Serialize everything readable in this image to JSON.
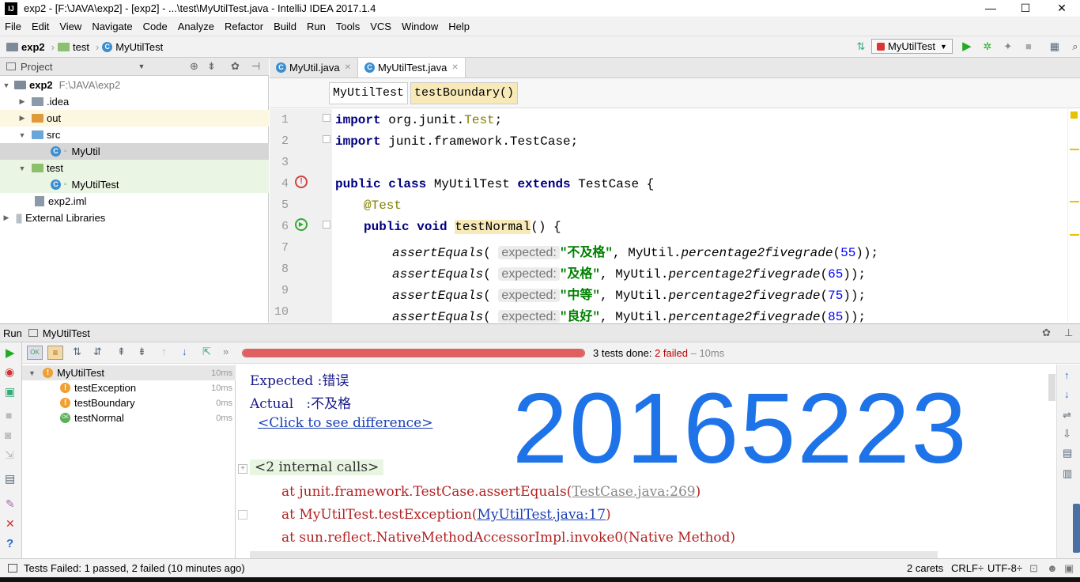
{
  "window": {
    "title": "exp2 - [F:\\JAVA\\exp2] - [exp2] - ...\\test\\MyUtilTest.java - IntelliJ IDEA 2017.1.4",
    "logo": "IJ",
    "minimize": "—",
    "maximize": "☐",
    "close": "✕"
  },
  "menu": [
    "File",
    "Edit",
    "View",
    "Navigate",
    "Code",
    "Analyze",
    "Refactor",
    "Build",
    "Run",
    "Tools",
    "VCS",
    "Window",
    "Help"
  ],
  "nav": {
    "crumbs": [
      "exp2",
      "test",
      "MyUtilTest"
    ],
    "run_config": "MyUtilTest"
  },
  "project": {
    "header": "Project",
    "items": [
      {
        "label": "exp2",
        "extra": "F:\\JAVA\\exp2",
        "arrow": "▼"
      },
      {
        "label": ".idea",
        "arrow": "▶"
      },
      {
        "label": "out",
        "arrow": "▶"
      },
      {
        "label": "src",
        "arrow": "▼"
      },
      {
        "label": "MyUtil",
        "arrow": ""
      },
      {
        "label": "test",
        "arrow": "▼"
      },
      {
        "label": "MyUtilTest",
        "arrow": ""
      },
      {
        "label": "exp2.iml",
        "arrow": ""
      },
      {
        "label": "External Libraries",
        "arrow": "▶"
      }
    ]
  },
  "editor": {
    "tabs": [
      "MyUtil.java",
      "MyUtilTest.java"
    ],
    "breadcrumb": [
      "MyUtilTest",
      "testBoundary()"
    ],
    "line_numbers": [
      "1",
      "2",
      "3",
      "4",
      "5",
      "6",
      "7",
      "8",
      "9",
      "10"
    ],
    "lines": {
      "l1_kw": "import",
      "l1_rest": " org.junit.",
      "l1_cls": "Test",
      "l1_end": ";",
      "l2_kw": "import",
      "l2_rest": " junit.framework.TestCase;",
      "l4_kw1": "public class",
      "l4_name": " MyUtilTest ",
      "l4_kw2": "extends",
      "l4_rest": " TestCase {",
      "l5": "@Test",
      "l6_kw": "public void",
      "l6_name": "testNormal",
      "l6_rest": "() {",
      "assert": "assertEquals",
      "hint": "expected:",
      "util": "MyUtil.",
      "method": "percentage2fivegrade",
      "r1_str": "\"不及格\"",
      "r1_num": "55",
      "r2_str": "\"及格\"",
      "r2_num": "65",
      "r3_str": "\"中等\"",
      "r3_num": "75",
      "r4_str": "\"良好\"",
      "r4_num": "85"
    }
  },
  "run": {
    "label": "Run",
    "config": "MyUtilTest",
    "progress": 1.0,
    "summary_prefix": "3 tests done: ",
    "summary_failed": "2 failed",
    "summary_time": " – 10ms",
    "tests": [
      {
        "name": "MyUtilTest",
        "time": "10ms",
        "status": "warn"
      },
      {
        "name": "testException",
        "time": "10ms",
        "status": "warn"
      },
      {
        "name": "testBoundary",
        "time": "0ms",
        "status": "warn"
      },
      {
        "name": "testNormal",
        "time": "0ms",
        "status": "ok"
      }
    ],
    "console": {
      "expected": "Expected :错误",
      "actual": "Actual   :不及格",
      "diff_link": "<Click to see difference>",
      "internal_calls": "<2 internal calls>",
      "at1_prefix": "at junit.framework.TestCase.assertEquals(",
      "at1_link": "TestCase.java:269",
      "at2_prefix": "at MyUtilTest.testException(",
      "at2_link": "MyUtilTest.java:17",
      "at3": "at sun.reflect.NativeMethodAccessorImpl.invoke0(Native Method)",
      "close_paren": ")",
      "overlay_number": "20165223"
    }
  },
  "status": {
    "message": "Tests Failed: 1 passed, 2 failed (10 minutes ago)",
    "carets": "2 carets",
    "line_sep": "CRLF÷",
    "encoding": "UTF-8÷"
  },
  "colors": {
    "accent": "#1e73e8",
    "failed": "#c00000",
    "progress": "#e06060"
  }
}
